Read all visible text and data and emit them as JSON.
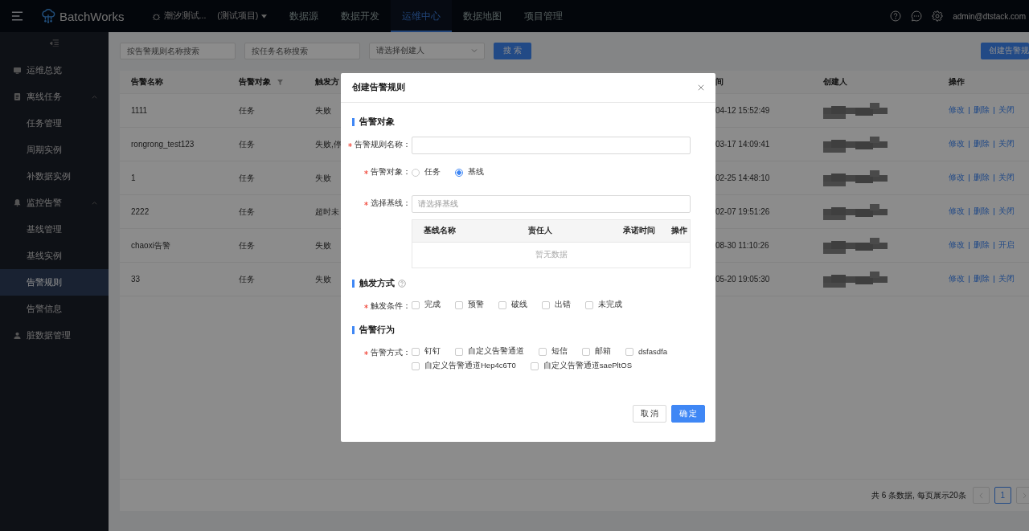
{
  "topbar": {
    "brand": "BatchWorks",
    "project": {
      "name": "潮汐测试...",
      "tag": "(测试项目)"
    },
    "nav": [
      {
        "label": "数据源",
        "selected": false
      },
      {
        "label": "数据开发",
        "selected": false
      },
      {
        "label": "运维中心",
        "selected": true
      },
      {
        "label": "数据地图",
        "selected": false
      },
      {
        "label": "项目管理",
        "selected": false
      }
    ],
    "user": "admin@dtstack.com"
  },
  "sidebar": {
    "items": [
      {
        "label": "运维总览",
        "selected": false
      },
      {
        "label": "离线任务",
        "selected": false,
        "expanded": true,
        "children": [
          {
            "label": "任务管理",
            "selected": false
          },
          {
            "label": "周期实例",
            "selected": false
          },
          {
            "label": "补数据实例",
            "selected": false
          }
        ]
      },
      {
        "label": "监控告警",
        "selected": false,
        "expanded": true,
        "children": [
          {
            "label": "基线管理",
            "selected": false
          },
          {
            "label": "基线实例",
            "selected": false
          },
          {
            "label": "告警规则",
            "selected": true
          },
          {
            "label": "告警信息",
            "selected": false
          }
        ]
      },
      {
        "label": "脏数据管理",
        "selected": false
      }
    ]
  },
  "filters": {
    "rule_search": {
      "placeholder": "按告警规则名称搜索"
    },
    "task_search": {
      "placeholder": "按任务名称搜索"
    },
    "creator_select": {
      "placeholder": "请选择创建人"
    },
    "search_button": "搜 索",
    "create_button": "创建告警规"
  },
  "table": {
    "columns": [
      "告警名称",
      "告警对象",
      "触发方",
      "间",
      "创建人",
      "操作"
    ],
    "rows": [
      {
        "name": "1111",
        "target": "任务",
        "trigger": "失败",
        "time": "04-12 15:52:49",
        "actions": [
          "修改",
          "删除",
          "关闭"
        ]
      },
      {
        "name": "rongrong_test123",
        "target": "任务",
        "trigger": "失败,停",
        "time": "03-17 14:09:41",
        "actions": [
          "修改",
          "删除",
          "关闭"
        ]
      },
      {
        "name": "1",
        "target": "任务",
        "trigger": "失败",
        "time": "02-25 14:48:10",
        "actions": [
          "修改",
          "删除",
          "关闭"
        ]
      },
      {
        "name": "2222",
        "target": "任务",
        "trigger": "超时未",
        "time": "02-07 19:51:26",
        "actions": [
          "修改",
          "删除",
          "关闭"
        ]
      },
      {
        "name": "chaoxi告警",
        "target": "任务",
        "trigger": "失败",
        "time": "08-30 11:10:26",
        "actions": [
          "修改",
          "删除",
          "开启"
        ]
      },
      {
        "name": "33",
        "target": "任务",
        "trigger": "失败",
        "time": "05-20 19:05:30",
        "actions": [
          "修改",
          "删除",
          "关闭"
        ]
      }
    ],
    "summary": "共 6 条数据, 每页展示20条",
    "pages": [
      {
        "label": "1",
        "selected": true
      }
    ]
  },
  "modal": {
    "title": "创建告警规则",
    "sections": [
      {
        "title": "告警对象",
        "fields": [
          {
            "kind": "input",
            "label": "告警规则名称：",
            "required": true
          },
          {
            "kind": "radio",
            "label": "告警对象：",
            "required": true,
            "options": [
              {
                "label": "任务",
                "selected": false
              },
              {
                "label": "基线",
                "selected": true
              }
            ]
          },
          {
            "kind": "select",
            "label": "选择基线：",
            "required": true,
            "placeholder": "请选择基线",
            "table": {
              "columns": [
                "基线名称",
                "责任人",
                "承诺时间",
                "操作"
              ],
              "empty": "暂无数据"
            }
          }
        ]
      },
      {
        "title": "触发方式",
        "help": true,
        "fields": [
          {
            "kind": "checkbox",
            "label": "触发条件：",
            "required": true,
            "options": [
              {
                "label": "完成",
                "checked": false
              },
              {
                "label": "预警",
                "checked": false
              },
              {
                "label": "破线",
                "checked": false
              },
              {
                "label": "出错",
                "checked": false
              },
              {
                "label": "未完成",
                "checked": false
              }
            ]
          }
        ]
      },
      {
        "title": "告警行为",
        "fields": [
          {
            "kind": "checkbox",
            "label": "告警方式：",
            "required": true,
            "options": [
              {
                "label": "钉钉",
                "checked": false
              },
              {
                "label": "自定义告警通道",
                "checked": false
              },
              {
                "label": "短信",
                "checked": false
              },
              {
                "label": "邮箱",
                "checked": false
              },
              {
                "label": "dsfasdfa",
                "checked": false
              },
              {
                "label": "自定义告警通道Hep4c6T0",
                "checked": false
              },
              {
                "label": "自定义告警通道saePltOS",
                "checked": false
              }
            ]
          }
        ]
      }
    ],
    "buttons": [
      {
        "label": "取 消",
        "kind": "secondary"
      },
      {
        "label": "确 定",
        "kind": "primary"
      }
    ]
  }
}
